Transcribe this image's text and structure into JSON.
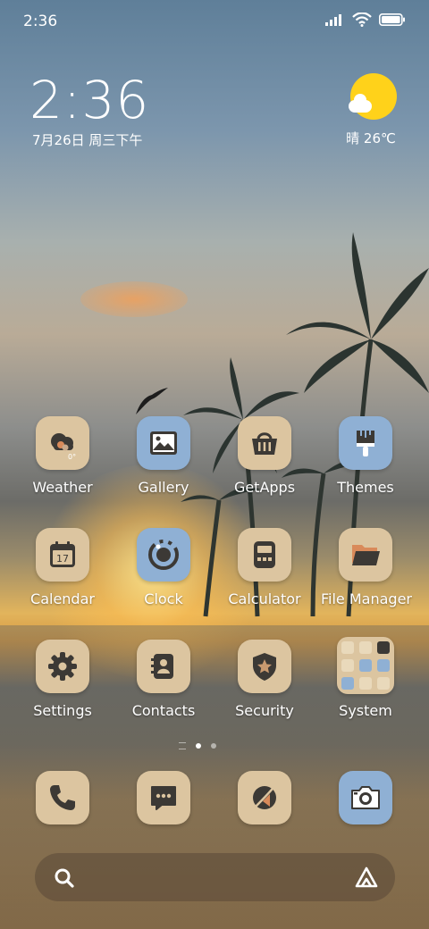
{
  "status_bar": {
    "time": "2:36"
  },
  "clock_widget": {
    "time": "2:36",
    "date": "7月26日 周三下午"
  },
  "weather_widget": {
    "text": "晴 26℃",
    "icon": "sunny-partly-cloudy-icon"
  },
  "apps": [
    {
      "label": "Weather",
      "icon": "weather-icon"
    },
    {
      "label": "Gallery",
      "icon": "gallery-icon"
    },
    {
      "label": "GetApps",
      "icon": "basket-icon"
    },
    {
      "label": "Themes",
      "icon": "paintbrush-icon"
    },
    {
      "label": "Calendar",
      "icon": "calendar-icon",
      "badge": "17"
    },
    {
      "label": "Clock",
      "icon": "clock-icon"
    },
    {
      "label": "Calculator",
      "icon": "calculator-icon"
    },
    {
      "label": "File Manager",
      "icon": "folder-icon"
    },
    {
      "label": "Settings",
      "icon": "gear-icon"
    },
    {
      "label": "Contacts",
      "icon": "contacts-icon"
    },
    {
      "label": "Security",
      "icon": "shield-star-icon"
    },
    {
      "label": "System",
      "icon": "folder-grid-icon"
    }
  ],
  "weather_icon_text": "0°",
  "dock": [
    {
      "icon": "phone-icon"
    },
    {
      "icon": "message-icon"
    },
    {
      "icon": "browser-icon"
    },
    {
      "icon": "camera-icon"
    }
  ],
  "page_indicator": {
    "pages": 2,
    "active": 1
  },
  "colors": {
    "icon_beige": "#dcc5a0",
    "icon_blue": "#8fb0d4",
    "icon_glyph": "#3c3935",
    "sun": "#ffd21a"
  }
}
